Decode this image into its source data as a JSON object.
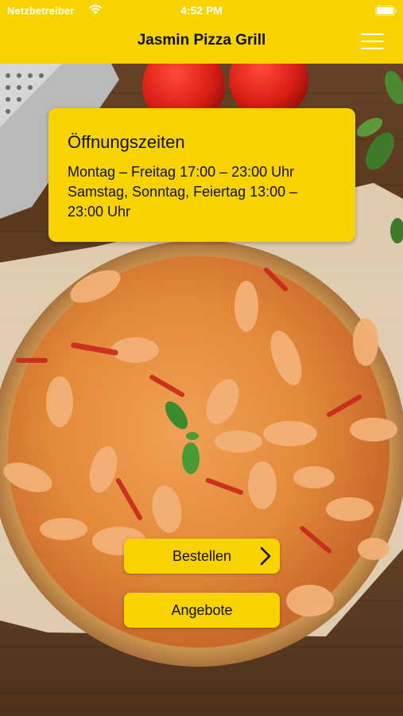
{
  "status_bar": {
    "carrier": "Netzbetreiber",
    "time": "4:52 PM",
    "icons": [
      "wifi-icon",
      "battery-icon"
    ]
  },
  "nav": {
    "title": "Jasmin Pizza Grill",
    "menu_icon": "hamburger-menu-icon"
  },
  "hours": {
    "title": "Öffnungszeiten",
    "lines": [
      "Montag – Freitag 17:00 – 23:00 Uhr",
      "Samstag, Sonntag, Feiertag 13:00 –",
      "23:00 Uhr"
    ]
  },
  "buttons": {
    "order_label": "Bestellen",
    "order_icon": "chevron-right-icon",
    "offers_label": "Angebote"
  },
  "colors": {
    "accent": "#f8d300",
    "text": "#111111",
    "status_text": "#ffffff"
  }
}
